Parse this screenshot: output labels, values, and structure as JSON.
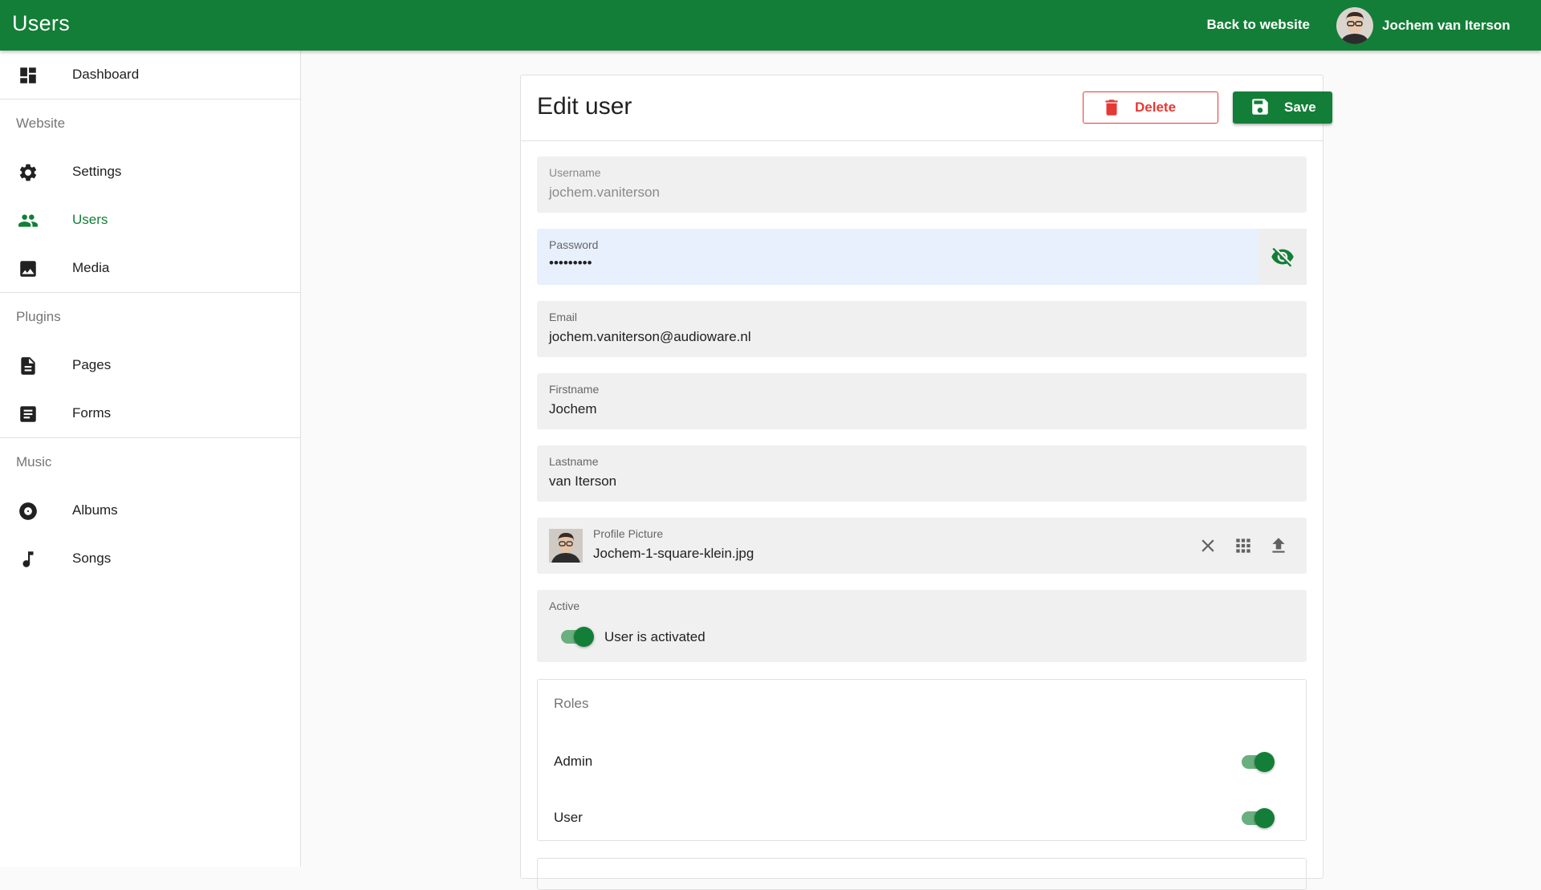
{
  "appbar": {
    "title": "Users",
    "back_link": "Back to website",
    "user_name": "Jochem van Iterson"
  },
  "sidebar": {
    "top_item": {
      "label": "Dashboard",
      "icon": "dashboard-icon"
    },
    "sections": [
      {
        "title": "Website",
        "items": [
          {
            "label": "Settings",
            "icon": "gear-icon"
          },
          {
            "label": "Users",
            "icon": "users-icon",
            "active": true
          },
          {
            "label": "Media",
            "icon": "image-icon"
          }
        ]
      },
      {
        "title": "Plugins",
        "items": [
          {
            "label": "Pages",
            "icon": "page-icon"
          },
          {
            "label": "Forms",
            "icon": "form-icon"
          }
        ]
      },
      {
        "title": "Music",
        "items": [
          {
            "label": "Albums",
            "icon": "album-icon"
          },
          {
            "label": "Songs",
            "icon": "music-note-icon"
          }
        ]
      }
    ]
  },
  "edit": {
    "title": "Edit user",
    "delete_label": "Delete",
    "save_label": "Save",
    "fields": {
      "username": {
        "label": "Username",
        "value": "jochem.vaniterson"
      },
      "password": {
        "label": "Password",
        "value": "•••••••••"
      },
      "email": {
        "label": "Email",
        "value": "jochem.vaniterson@audioware.nl"
      },
      "firstname": {
        "label": "Firstname",
        "value": "Jochem"
      },
      "lastname": {
        "label": "Lastname",
        "value": "van Iterson"
      },
      "picture": {
        "label": "Profile Picture",
        "value": "Jochem-1-square-klein.jpg"
      }
    },
    "active": {
      "label": "Active",
      "switch_label": "User is activated",
      "on": true
    },
    "roles": {
      "title": "Roles",
      "items": [
        {
          "label": "Admin",
          "on": true
        },
        {
          "label": "User",
          "on": true
        }
      ]
    }
  },
  "colors": {
    "primary": "#137e37",
    "danger": "#e53935",
    "autofill": "#e8f0fe"
  }
}
